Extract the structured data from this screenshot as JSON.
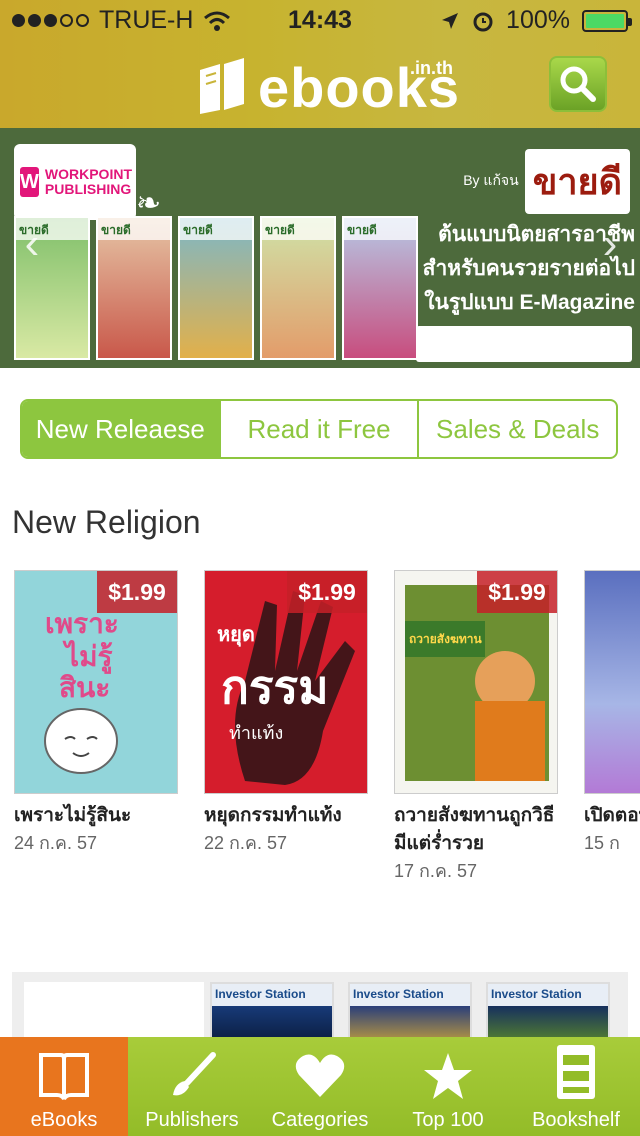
{
  "status_bar": {
    "carrier": "TRUE-H",
    "time": "14:43",
    "battery": "100%"
  },
  "header": {
    "logo_text": "ebooks",
    "logo_suffix": ".in.th"
  },
  "banner": {
    "publisher_logo_text": "WORKPOINT PUBLISHING",
    "magazine_by": "By แก้จน",
    "magazine_name": "ขายดี",
    "cover_mast": "ขายดี",
    "cover_count": 5,
    "tagline_lines": [
      "ต้นแบบนิตยสารอาชีพ",
      "สำหรับคนรวยรายต่อไป",
      "ในรูปแบบ E-Magazine"
    ]
  },
  "segments": [
    {
      "label": "New Releaese",
      "active": true
    },
    {
      "label": "Read it Free",
      "active": false
    },
    {
      "label": "Sales & Deals",
      "active": false
    }
  ],
  "section": {
    "title": "New Religion"
  },
  "books": [
    {
      "title": "เพราะไม่รู้สินะ",
      "date": "24 ก.ค. 57",
      "price": "$1.99",
      "cover_color": "#8fd3d8"
    },
    {
      "title": "หยุดกรรมทำแท้ง",
      "date": "22 ก.ค. 57",
      "price": "$1.99",
      "cover_color": "#d51d2c"
    },
    {
      "title": "ถวายสังฆทานถูกวิธี มีแต่ร่ำรวย",
      "date": "17 ก.ค. 57",
      "price": "$1.99",
      "cover_color": "#7a9a3a"
    },
    {
      "title": "เปิดตอบ",
      "date": "15 ก",
      "price": "",
      "cover_color": "#6b7cc2"
    }
  ],
  "strip": {
    "magazine_name": "Investor Station"
  },
  "tabs": [
    {
      "label": "eBooks",
      "icon": "book-icon",
      "active": true
    },
    {
      "label": "Publishers",
      "icon": "brush-icon",
      "active": false
    },
    {
      "label": "Categories",
      "icon": "heart-icon",
      "active": false
    },
    {
      "label": "Top 100",
      "icon": "star-icon",
      "active": false
    },
    {
      "label": "Bookshelf",
      "icon": "bookshelf-icon",
      "active": false
    }
  ],
  "colors": {
    "accent_green": "#8dc63f",
    "active_tab_orange": "#e8751e",
    "price_red": "#c62028"
  }
}
